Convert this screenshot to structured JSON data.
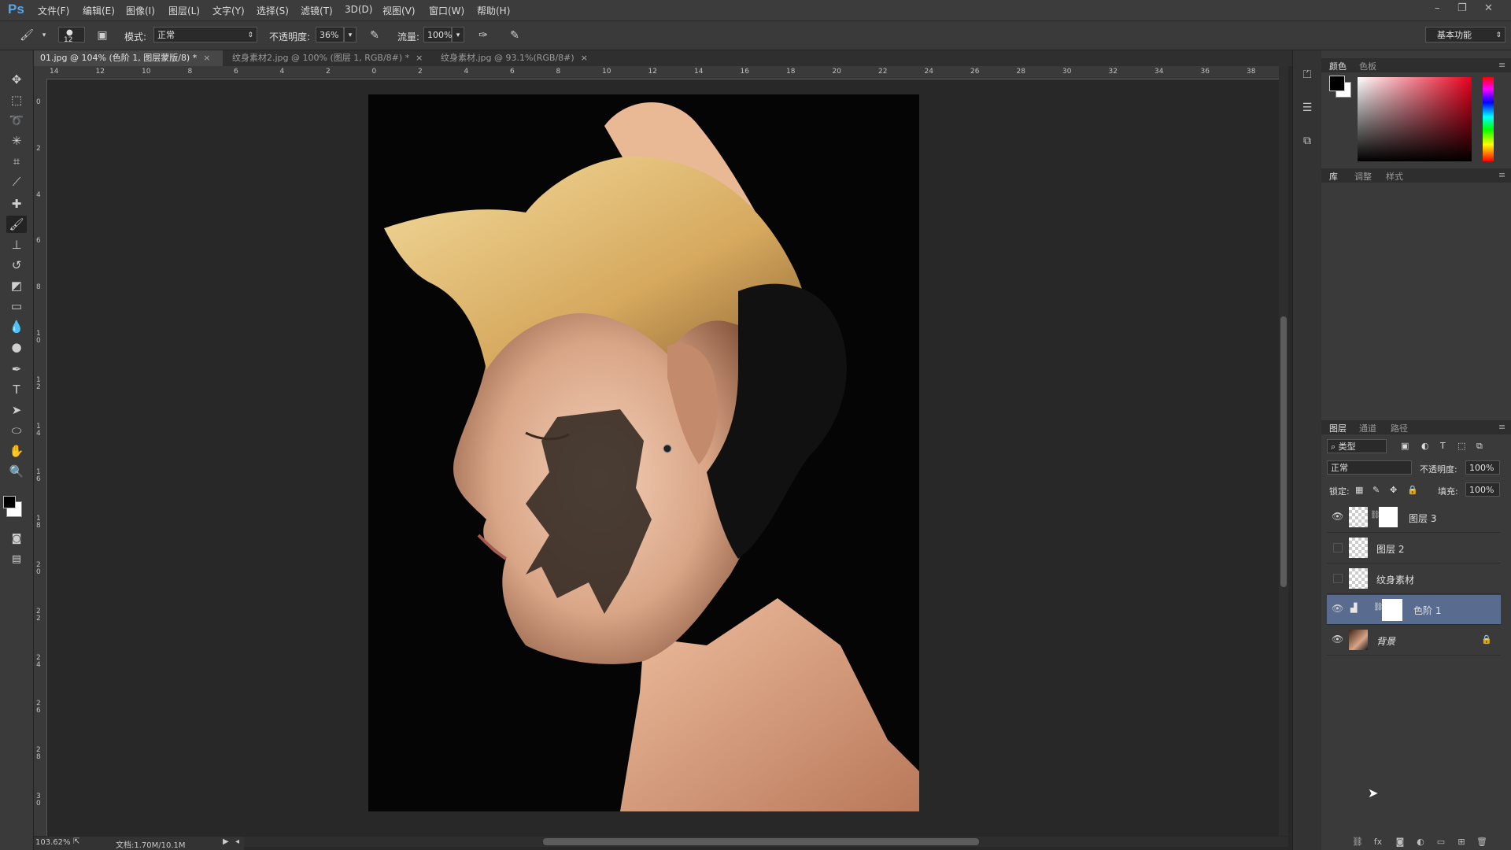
{
  "app": {
    "logo": "Ps",
    "workspace": "基本功能"
  },
  "menu": [
    "文件(F)",
    "编辑(E)",
    "图像(I)",
    "图层(L)",
    "文字(Y)",
    "选择(S)",
    "滤镜(T)",
    "3D(D)",
    "视图(V)",
    "窗口(W)",
    "帮助(H)"
  ],
  "options": {
    "brush_size": "12",
    "mode_label": "模式:",
    "mode_value": "正常",
    "opacity_label": "不透明度:",
    "opacity_value": "36%",
    "flow_label": "流量:",
    "flow_value": "100%"
  },
  "tabs": [
    {
      "label": "01.jpg @ 104% (色阶 1, 图层蒙版/8) *",
      "close": "×"
    },
    {
      "label": "纹身素材2.jpg @ 100% (图层 1, RGB/8#) *",
      "close": "×"
    },
    {
      "label": "纹身素材.jpg @ 93.1%(RGB/8#)",
      "close": "×"
    }
  ],
  "ruler_h": [
    "14",
    "12",
    "10",
    "8",
    "6",
    "4",
    "2",
    "0",
    "2",
    "4",
    "6",
    "8",
    "10",
    "12",
    "14",
    "16",
    "18",
    "20",
    "22",
    "24",
    "26",
    "28",
    "30",
    "32",
    "34",
    "36",
    "38"
  ],
  "ruler_v": [
    "0",
    "2",
    "4",
    "6",
    "8",
    "1\n0",
    "1\n2",
    "1\n4",
    "1\n6",
    "1\n8",
    "2\n0",
    "2\n2",
    "2\n4",
    "2\n6",
    "2\n8",
    "3\n0"
  ],
  "status": {
    "zoom": "103.62%",
    "doc": "文档:1.70M/10.1M"
  },
  "panels": {
    "color_tabs": [
      "颜色",
      "色板"
    ],
    "lib_tabs": [
      "库",
      "调整",
      "样式"
    ],
    "layer_tabs": [
      "图层",
      "通道",
      "路径"
    ],
    "filter_kind": "类型",
    "blend_mode": "正常",
    "opacity_label": "不透明度:",
    "opacity_value": "100%",
    "lock_label": "锁定:",
    "fill_label": "填充:",
    "fill_value": "100%"
  },
  "colors": {
    "foreground": "#000000",
    "background": "#ffffff"
  },
  "layers": [
    {
      "name": "图层 3",
      "visible": true,
      "selected": false
    },
    {
      "name": "图层 2",
      "visible": false,
      "selected": false
    },
    {
      "name": "纹身素材",
      "visible": false,
      "selected": false
    },
    {
      "name": "色阶 1",
      "visible": true,
      "selected": true
    },
    {
      "name": "背景",
      "visible": true,
      "selected": false
    }
  ]
}
